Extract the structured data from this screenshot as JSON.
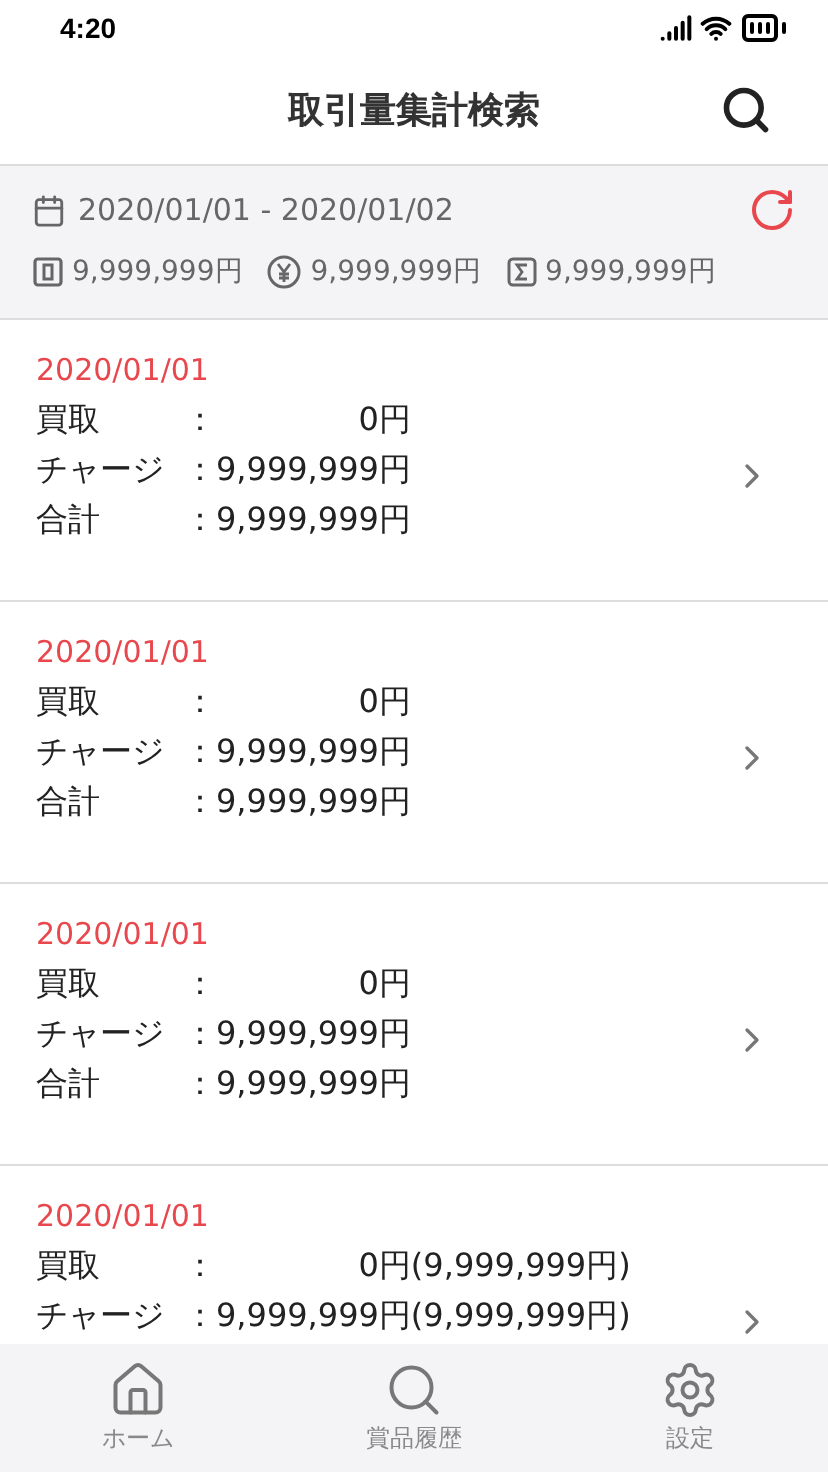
{
  "status_bar": {
    "time": "4:20"
  },
  "header": {
    "title": "取引量集計検索"
  },
  "summary": {
    "period": "2020/01/01 - 2020/01/02",
    "totals": [
      {
        "kind": "register",
        "value": "9,999,999円"
      },
      {
        "kind": "yen",
        "value": "9,999,999円"
      },
      {
        "kind": "sum",
        "value": "9,999,999円"
      }
    ]
  },
  "records": [
    {
      "date": "2020/01/01",
      "rows": [
        {
          "label": "買取",
          "separator": "：",
          "value": "0円"
        },
        {
          "label": "チャージ",
          "separator": "：",
          "value": "9,999,999円"
        },
        {
          "label": "合計",
          "separator": "：",
          "value": "9,999,999円"
        }
      ]
    },
    {
      "date": "2020/01/01",
      "rows": [
        {
          "label": "買取",
          "separator": "：",
          "value": "0円"
        },
        {
          "label": "チャージ",
          "separator": "：",
          "value": "9,999,999円"
        },
        {
          "label": "合計",
          "separator": "：",
          "value": "9,999,999円"
        }
      ]
    },
    {
      "date": "2020/01/01",
      "rows": [
        {
          "label": "買取",
          "separator": "：",
          "value": "0円"
        },
        {
          "label": "チャージ",
          "separator": "：",
          "value": "9,999,999円"
        },
        {
          "label": "合計",
          "separator": "：",
          "value": "9,999,999円"
        }
      ]
    },
    {
      "date": "2020/01/01",
      "rows": [
        {
          "label": "買取",
          "separator": "：",
          "value": "0円(9,999,999円)"
        },
        {
          "label": "チャージ",
          "separator": "：",
          "value": "9,999,999円(9,999,999円)"
        }
      ]
    }
  ],
  "tab_bar": [
    {
      "kind": "home",
      "label": "ホーム"
    },
    {
      "kind": "search",
      "label": "賞品履歴"
    },
    {
      "kind": "settings",
      "label": "設定"
    }
  ]
}
